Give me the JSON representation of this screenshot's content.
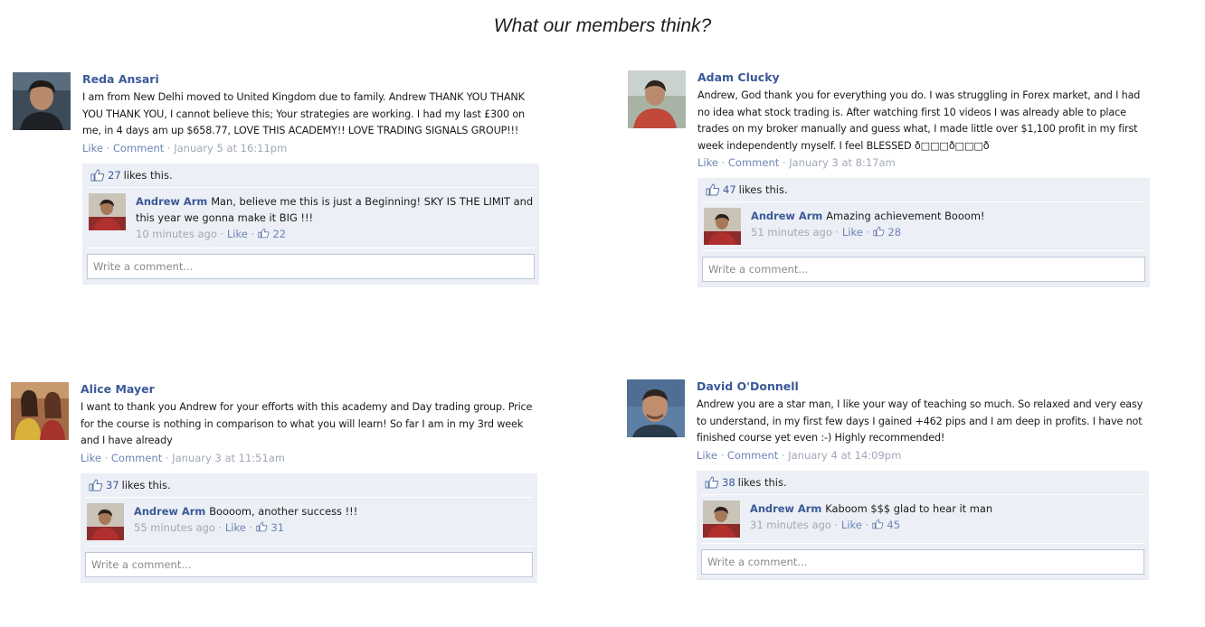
{
  "heading": "What our members think?",
  "colors": {
    "link_blue": "#3b5998",
    "feedback_bg": "#eceff5",
    "meta_grey": "#a0a7b6"
  },
  "posts": [
    {
      "author": "Reda Ansari",
      "text": "I am from New Delhi moved to United Kingdom due to family. Andrew THANK YOU THANK YOU THANK YOU, I cannot believe this; Your strategies are working. I had my last £300 on me, in 4 days am up $658.77, LOVE THIS ACADEMY!! LOVE TRADING SIGNALS GROUP!!!",
      "like_label": "Like",
      "comment_label": "Comment",
      "timestamp": "January 5 at 16:11pm",
      "likes_count": "27",
      "likes_suffix": "likes this.",
      "reply": {
        "author": "Andrew Arm",
        "text": "Man, believe me this is just a Beginning! SKY IS THE LIMIT and this year we gonna make it BIG !!!",
        "time": "10 minutes ago",
        "like_label": "Like",
        "likes": "22"
      },
      "write_placeholder": "Write a comment...",
      "avatar_icon": "person-avatar-icon"
    },
    {
      "author": "Adam Clucky",
      "text": "Andrew, God thank you for everything you do. I was struggling in Forex market, and I had no idea what stock trading is. After watching first 10 videos I was already able to place trades on my broker manually and guess what, I made little over $1,100 profit in my first week independently myself. I feel BLESSED ð□□□ð□□□ð",
      "like_label": "Like",
      "comment_label": "Comment",
      "timestamp": "January 3 at 8:17am",
      "likes_count": "47",
      "likes_suffix": "likes this.",
      "reply": {
        "author": "Andrew Arm",
        "text": "Amazing achievement Booom!",
        "time": "51 minutes ago",
        "like_label": "Like",
        "likes": "28"
      },
      "write_placeholder": "Write a comment...",
      "avatar_icon": "person-avatar-icon"
    },
    {
      "author": "Alice Mayer",
      "text": "I want to thank you Andrew for your efforts with this academy and Day trading group. Price for the course is nothing in comparison to what you will learn! So far I am in my 3rd week and I have already",
      "like_label": "Like",
      "comment_label": "Comment",
      "timestamp": "January 3 at 11:51am",
      "likes_count": "37",
      "likes_suffix": "likes this.",
      "reply": {
        "author": "Andrew Arm",
        "text": "Boooom, another success !!!",
        "time": "55 minutes ago",
        "like_label": "Like",
        "likes": "31"
      },
      "write_placeholder": "Write a comment...",
      "avatar_icon": "person-avatar-icon"
    },
    {
      "author": "David O'Donnell",
      "text": "Andrew you are a star man, I like your way of teaching so much. So relaxed and very easy to understand, in my first few days I gained +462 pips and I am deep in profits. I have not finished course yet even :-) Highly recommended!",
      "like_label": "Like",
      "comment_label": "Comment",
      "timestamp": "January 4 at 14:09pm",
      "likes_count": "38",
      "likes_suffix": "likes this.",
      "reply": {
        "author": "Andrew Arm",
        "text": "Kaboom $$$ glad to hear it man",
        "time": "31 minutes ago",
        "like_label": "Like",
        "likes": "45"
      },
      "write_placeholder": "Write a comment...",
      "avatar_icon": "person-avatar-icon"
    }
  ]
}
